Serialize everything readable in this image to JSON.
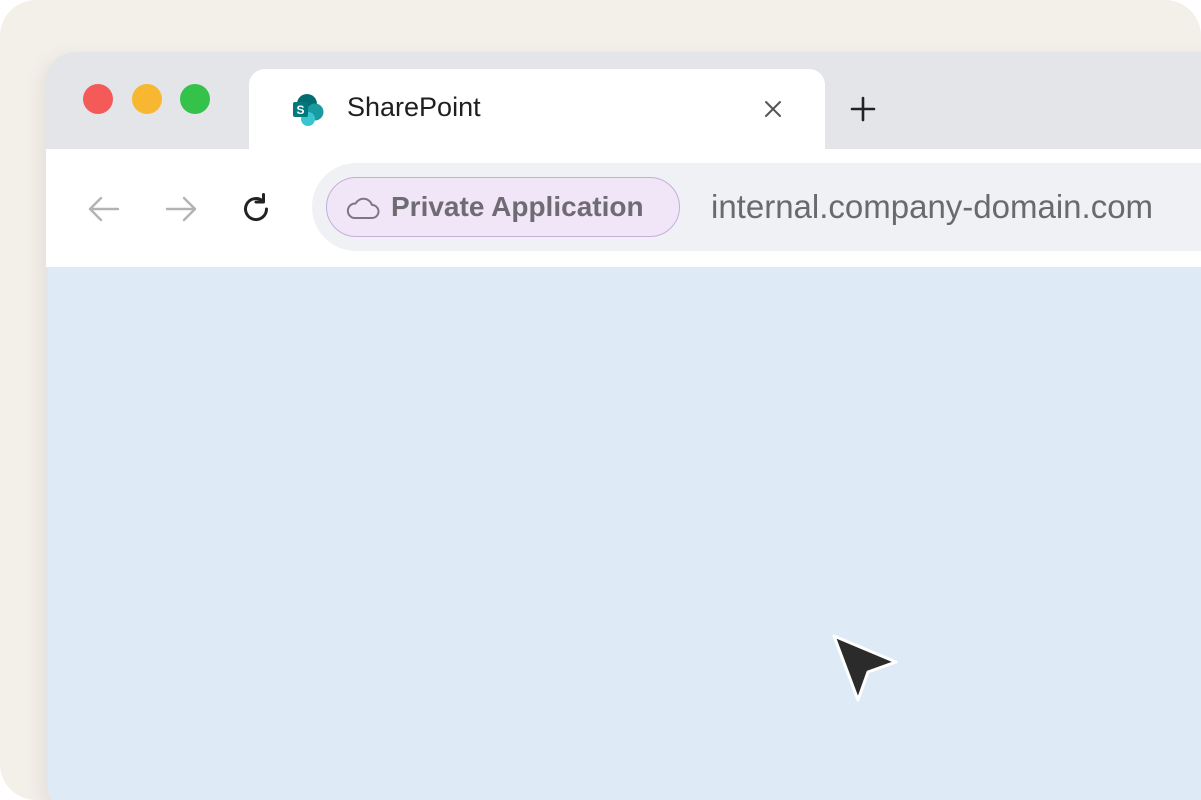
{
  "window": {
    "traffic_lights": {
      "close_color": "#f45a58",
      "minimize_color": "#f7b731",
      "maximize_color": "#35c24b"
    }
  },
  "tab": {
    "title": "SharePoint",
    "favicon": "sharepoint-logo-icon",
    "close_icon": "close-icon"
  },
  "new_tab_icon": "plus-icon",
  "toolbar": {
    "back_icon": "arrow-left-icon",
    "forward_icon": "arrow-right-icon",
    "reload_icon": "reload-icon"
  },
  "address_bar": {
    "badge_label": "Private Application",
    "badge_icon": "cloud-icon",
    "badge_color": "#f1e6f8",
    "url": "internal.company-domain.com"
  },
  "content": {
    "background_color": "#deebf7"
  },
  "cursor_icon": "mouse-pointer-icon"
}
